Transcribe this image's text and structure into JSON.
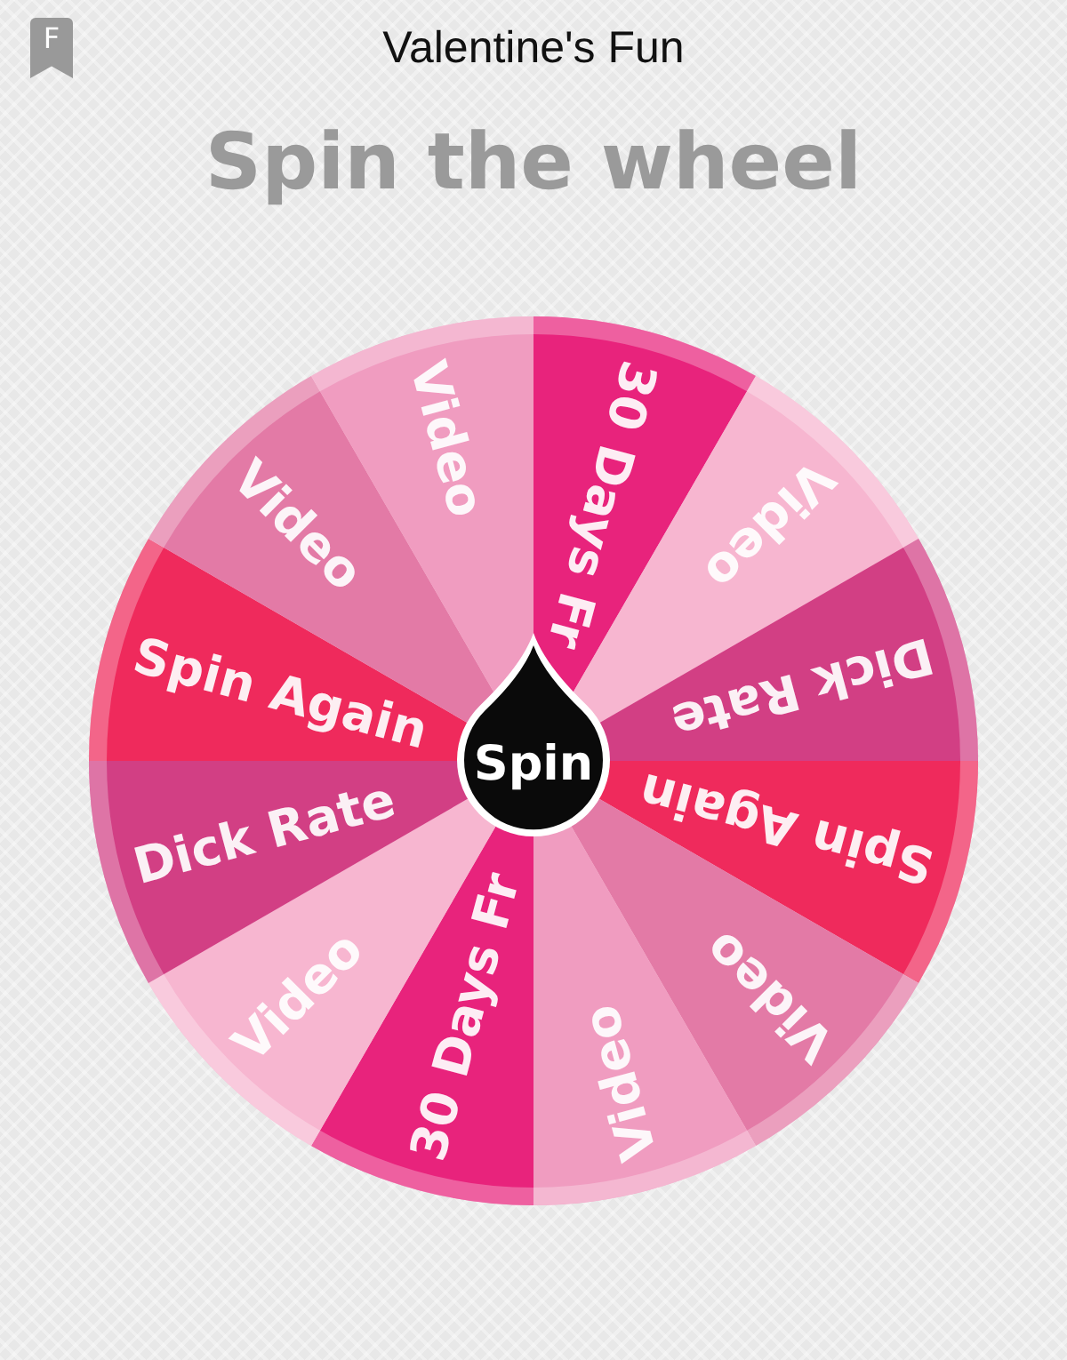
{
  "app_icon": {
    "letter": "F"
  },
  "window": {
    "title": "Valentine's Fun"
  },
  "heading": "Spin the wheel",
  "wheel": {
    "segments": [
      {
        "label": "30 Days Fr",
        "color": "#e8237c"
      },
      {
        "label": "Video",
        "color": "#f7b6d0"
      },
      {
        "label": "Dick Rate",
        "color": "#d23f84"
      },
      {
        "label": "Spin Again",
        "color": "#ef2a5c"
      },
      {
        "label": "Video",
        "color": "#e37aa6"
      },
      {
        "label": "Video",
        "color": "#f09cc0"
      },
      {
        "label": "30 Days Fr",
        "color": "#e8237c"
      },
      {
        "label": "Video",
        "color": "#f7b6d0"
      },
      {
        "label": "Dick Rate",
        "color": "#d23f84"
      },
      {
        "label": "Spin Again",
        "color": "#ef2a5c"
      },
      {
        "label": "Video",
        "color": "#e37aa6"
      },
      {
        "label": "Video",
        "color": "#f09cc0"
      }
    ],
    "spin_button": "Spin"
  }
}
